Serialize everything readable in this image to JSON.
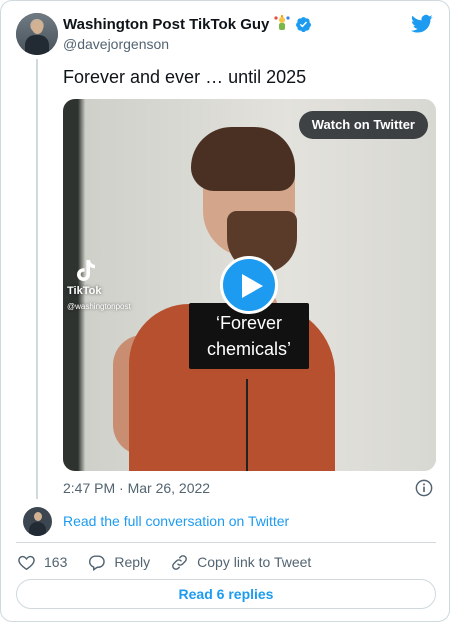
{
  "author": {
    "display_name": "Washington Post TikTok Guy",
    "handle": "@davejorgenson",
    "emoji_icon": "juggler-emoji-icon",
    "verified_icon": "verified-badge-icon"
  },
  "tweet": {
    "text": "Forever and ever … until 2025",
    "timestamp": "2:47 PM · Mar 26, 2022"
  },
  "media": {
    "watch_label": "Watch on Twitter",
    "tiktok_brand": "TikTok",
    "tiktok_user": "@washingtonpost",
    "caption_line1": "‘Forever",
    "caption_line2": "chemicals’",
    "play_icon": "play-icon"
  },
  "conversation": {
    "read_full_label": "Read the full conversation on Twitter"
  },
  "actions": {
    "like_count": "163",
    "reply_label": "Reply",
    "copy_link_label": "Copy link to Tweet"
  },
  "footer": {
    "read_replies_label": "Read 6 replies"
  },
  "colors": {
    "accent": "#1d9bf0",
    "text_primary": "#0f1419",
    "text_secondary": "#536471",
    "border": "#cfd9de"
  }
}
